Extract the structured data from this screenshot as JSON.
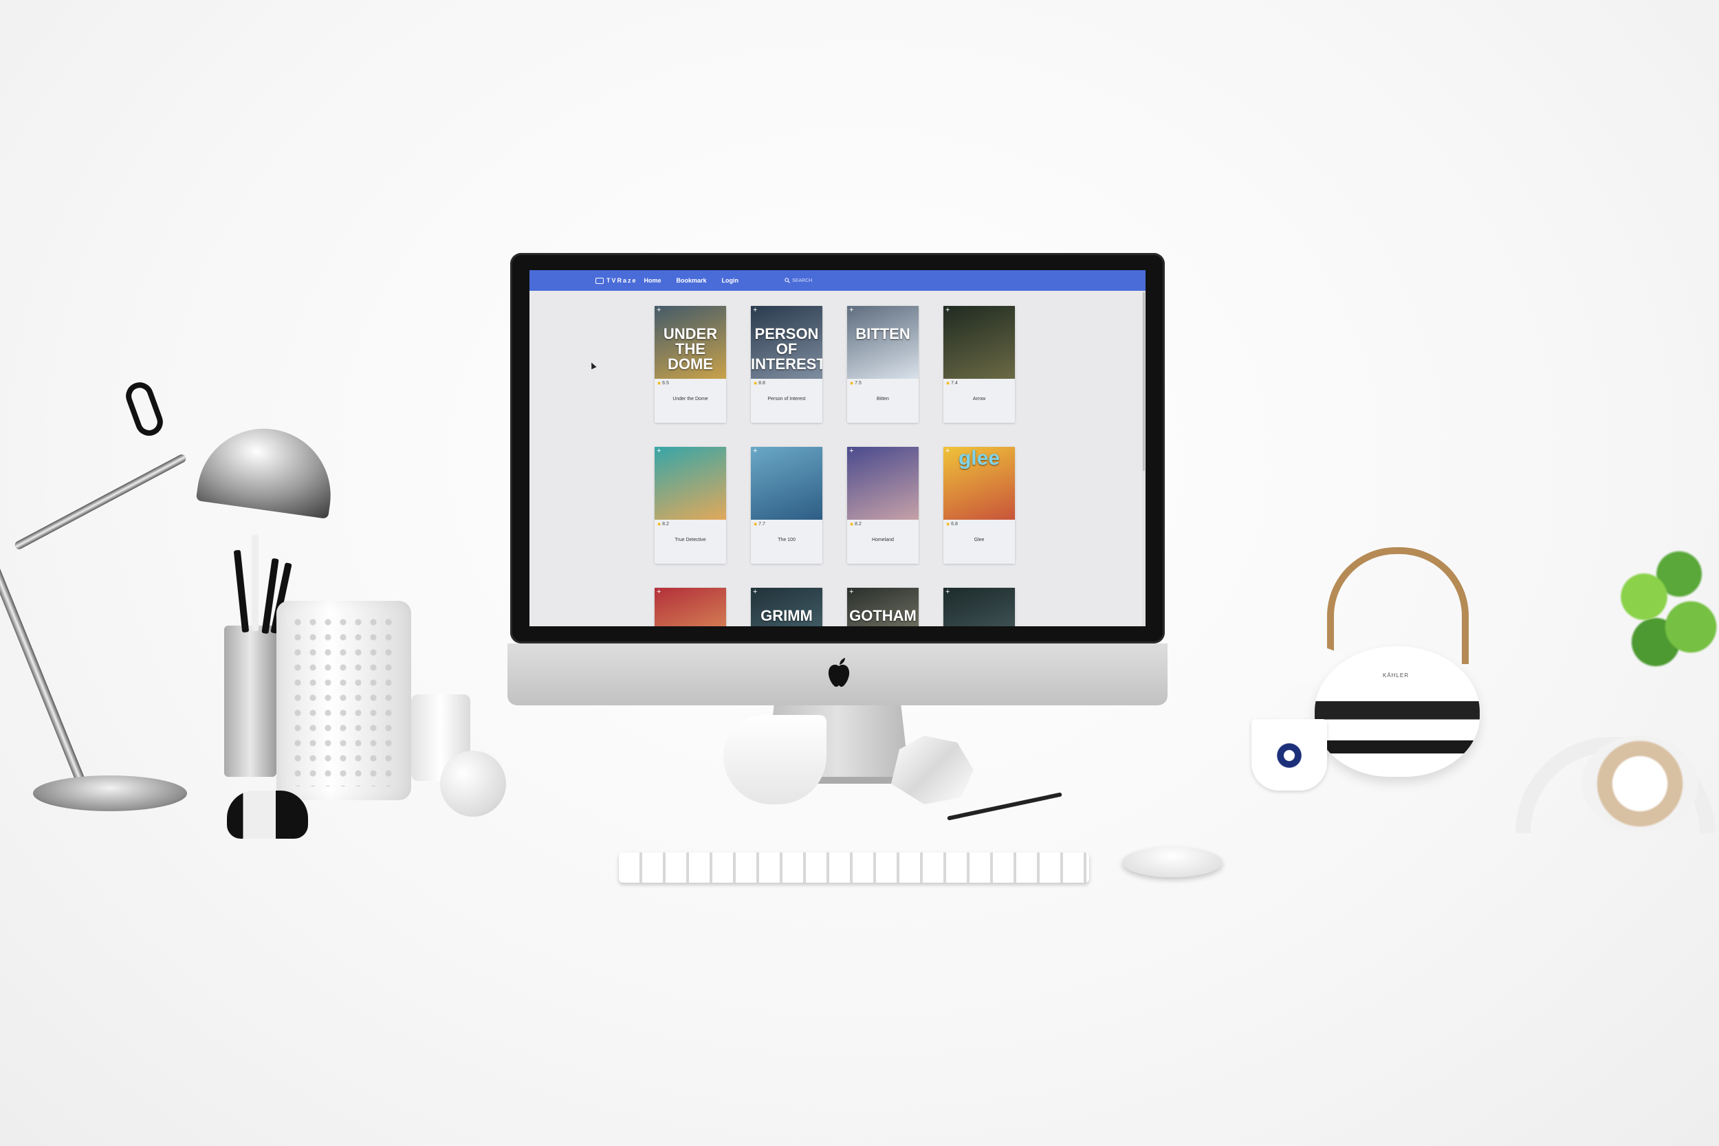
{
  "app": {
    "brand": "TVRaze",
    "nav": [
      "Home",
      "Bookmark",
      "Login"
    ],
    "search_placeholder": "SEARCH"
  },
  "shows": [
    {
      "title": "Under the Dome",
      "rating": "6.5",
      "poster_text": "UNDER THE DOME",
      "colors": [
        "#445b6a",
        "#c9a24a"
      ]
    },
    {
      "title": "Person of Interest",
      "rating": "8.8",
      "poster_text": "PERSON OF INTEREST",
      "colors": [
        "#2a3b4d",
        "#7f8ea0"
      ]
    },
    {
      "title": "Bitten",
      "rating": "7.5",
      "poster_text": "BITTEN",
      "colors": [
        "#5e6d7e",
        "#d9e1ea"
      ]
    },
    {
      "title": "Arrow",
      "rating": "7.4",
      "poster_text": "",
      "colors": [
        "#1f2a21",
        "#6b6a45"
      ]
    },
    {
      "title": "True Detective",
      "rating": "8.2",
      "poster_text": "",
      "colors": [
        "#36a6a8",
        "#e2a85a"
      ]
    },
    {
      "title": "The 100",
      "rating": "7.7",
      "poster_text": "",
      "colors": [
        "#6aa8c6",
        "#2e5d85"
      ]
    },
    {
      "title": "Homeland",
      "rating": "8.2",
      "poster_text": "",
      "colors": [
        "#4a4b8e",
        "#c6a1a8"
      ]
    },
    {
      "title": "Glee",
      "rating": "6.8",
      "poster_text": "glee",
      "colors": [
        "#f0c33a",
        "#c8543a"
      ]
    },
    {
      "title": "",
      "rating": "",
      "poster_text": "",
      "colors": [
        "#b3303a",
        "#e2a260"
      ]
    },
    {
      "title": "",
      "rating": "",
      "poster_text": "GRIMM",
      "colors": [
        "#21323a",
        "#50707a"
      ]
    },
    {
      "title": "",
      "rating": "",
      "poster_text": "GOTHAM",
      "colors": [
        "#2b2f2c",
        "#8c8d7a"
      ]
    },
    {
      "title": "",
      "rating": "",
      "poster_text": "",
      "colors": [
        "#1c2a2a",
        "#4f6468"
      ]
    }
  ],
  "props": {
    "teapot_brand": "KÄHLER"
  },
  "colors": {
    "navbar": "#4a6cd8",
    "star": "#f3b400"
  },
  "icons": {
    "brand": "tv-icon",
    "search": "search-icon",
    "add": "plus-icon",
    "star": "star-icon",
    "system": "apple-logo-icon"
  }
}
